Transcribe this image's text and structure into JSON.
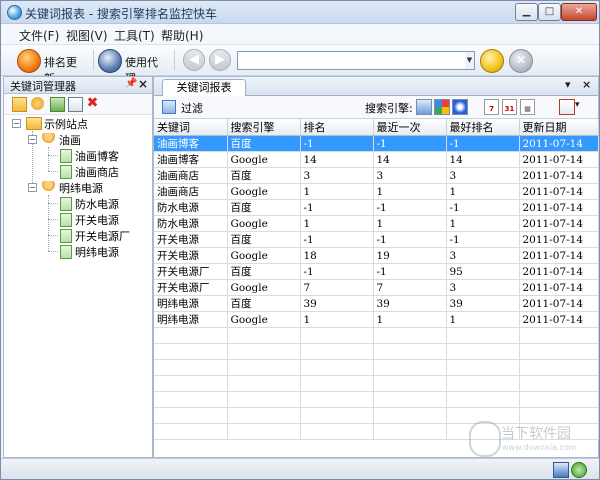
{
  "window": {
    "title": "关键词报表 - 搜索引擎排名监控快车"
  },
  "menu": {
    "items": [
      "文件(F)",
      "视图(V)",
      "工具(T)",
      "帮助(H)"
    ]
  },
  "toolbar": {
    "update_rank_label": "排名更新",
    "use_proxy_label": "使用代理",
    "address_value": ""
  },
  "left_panel": {
    "title": "关键词管理器",
    "tree": {
      "root": "示例站点",
      "groups": [
        {
          "name": "油画",
          "items": [
            "油画博客",
            "油画商店"
          ]
        },
        {
          "name": "明纬电源",
          "items": [
            "防水电源",
            "开关电源",
            "开关电源厂",
            "明纬电源"
          ]
        }
      ]
    }
  },
  "report": {
    "tab_label": "关键词报表",
    "filter_label": "过滤",
    "engine_label": "搜索引擎:",
    "columns": [
      "关键词",
      "搜索引擎",
      "排名",
      "最近一次",
      "最好排名",
      "更新日期"
    ],
    "rows": [
      [
        "油画博客",
        "百度",
        "-1",
        "-1",
        "-1",
        "2011-07-14"
      ],
      [
        "油画博客",
        "Google",
        "14",
        "14",
        "14",
        "2011-07-14"
      ],
      [
        "油画商店",
        "百度",
        "3",
        "3",
        "3",
        "2011-07-14"
      ],
      [
        "油画商店",
        "Google",
        "1",
        "1",
        "1",
        "2011-07-14"
      ],
      [
        "防水电源",
        "百度",
        "-1",
        "-1",
        "-1",
        "2011-07-14"
      ],
      [
        "防水电源",
        "Google",
        "1",
        "1",
        "1",
        "2011-07-14"
      ],
      [
        "开关电源",
        "百度",
        "-1",
        "-1",
        "-1",
        "2011-07-14"
      ],
      [
        "开关电源",
        "Google",
        "18",
        "19",
        "3",
        "2011-07-14"
      ],
      [
        "开关电源厂",
        "百度",
        "-1",
        "-1",
        "95",
        "2011-07-14"
      ],
      [
        "开关电源厂",
        "Google",
        "7",
        "7",
        "3",
        "2011-07-14"
      ],
      [
        "明纬电源",
        "百度",
        "39",
        "39",
        "39",
        "2011-07-14"
      ],
      [
        "明纬电源",
        "Google",
        "1",
        "1",
        "1",
        "2011-07-14"
      ]
    ],
    "selected_row": 0
  },
  "watermark": {
    "text": "当下软件园",
    "url": "www.downxia.com"
  },
  "colors": {
    "selection": "#3399ff",
    "titlebar": "#c9d9ee",
    "close_button": "#c7452f"
  }
}
